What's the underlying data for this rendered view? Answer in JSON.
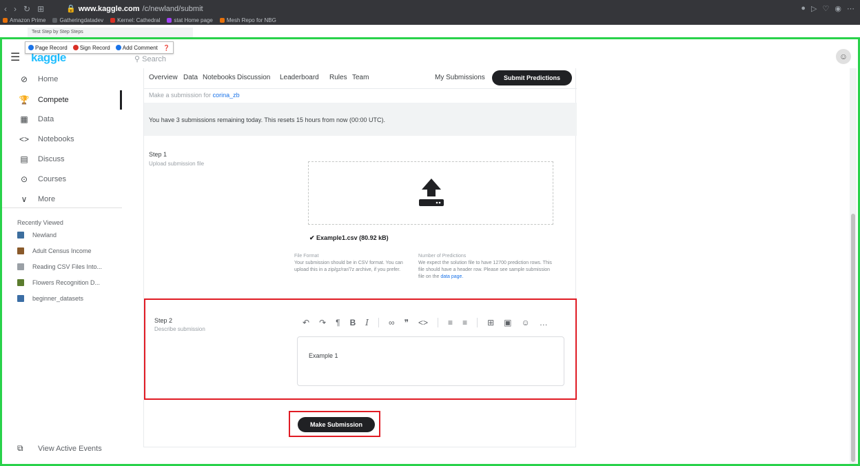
{
  "browser": {
    "url_host": "www.kaggle.com",
    "url_path": "/c/newland/submit",
    "bookmarks": [
      {
        "label": "Amazon Prime",
        "color": "#e8710a"
      },
      {
        "label": "Gatheringdatadev",
        "color": "#5f6368"
      },
      {
        "label": "Kernel: Cathedral",
        "color": "#d93025"
      },
      {
        "label": "stat Home page",
        "color": "#a142f4"
      },
      {
        "label": "Mesh Repo for NBG",
        "color": "#e8710a"
      }
    ],
    "tab_ghost": "Test Step by Step Steps"
  },
  "recorder": {
    "items": [
      {
        "label": "Page Record",
        "color": "#1a73e8"
      },
      {
        "label": "Sign Record",
        "color": "#d93025"
      },
      {
        "label": "Add Comment",
        "color": "#1a73e8"
      }
    ]
  },
  "header": {
    "logo": "kaggle",
    "search_placeholder": "Search"
  },
  "sidebar": {
    "items": [
      {
        "label": "Home",
        "icon": "⊘"
      },
      {
        "label": "Compete",
        "icon": "🏆"
      },
      {
        "label": "Data",
        "icon": "▦"
      },
      {
        "label": "Notebooks",
        "icon": "<>"
      },
      {
        "label": "Discuss",
        "icon": "▤"
      },
      {
        "label": "Courses",
        "icon": "⊙"
      },
      {
        "label": "More",
        "icon": "∨"
      }
    ],
    "recent_title": "Recently Viewed",
    "recent": [
      {
        "label": "Newland",
        "color": "#3c6e9e"
      },
      {
        "label": "Adult Census Income",
        "color": "#8a5a2b"
      },
      {
        "label": "Reading CSV Files Into...",
        "color": "#9aa0a6"
      },
      {
        "label": "Flowers Recognition D...",
        "color": "#5b7c2e"
      },
      {
        "label": "beginner_datasets",
        "color": "#3b6ea5"
      }
    ],
    "view_events": "View Active Events"
  },
  "competition": {
    "tabs": [
      "Overview",
      "Data",
      "Notebooks",
      "Discussion",
      "Leaderboard",
      "Rules",
      "Team"
    ],
    "my_submissions": "My Submissions",
    "submit_predictions": "Submit Predictions",
    "subtitle_prefix": "Make a submission for",
    "subtitle_dataset": "corina_zb",
    "remaining_text": "You have 3 submissions remaining today. This resets 15 hours from now (00:00 UTC).",
    "step1_title": "Step 1",
    "step1_desc": "Upload submission file",
    "uploaded_file": "✔ Example1.csv (80.92 kB)",
    "file_format_title": "File Format",
    "file_format_text": "Your submission should be in CSV format. You can upload this in a zip/gz/rar/7z archive, if you prefer.",
    "num_predictions_title": "Number of Predictions",
    "num_predictions_text": "We expect the solution file to have 12700 prediction rows. This file should have a header row. Please see sample submission file on the",
    "data_page_link": "data page.",
    "step2_title": "Step 2",
    "step2_desc": "Describe submission",
    "editor_text": "Example 1",
    "make_submission": "Make Submission"
  }
}
